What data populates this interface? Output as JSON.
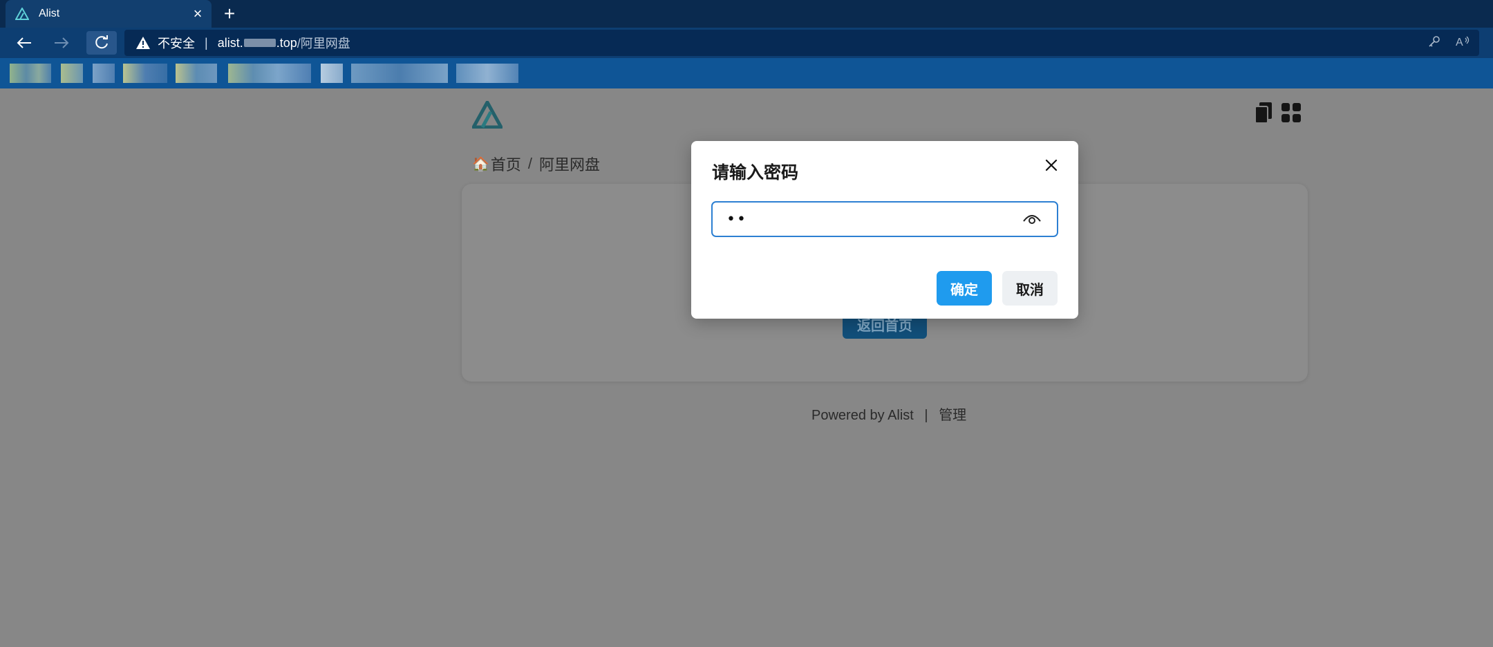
{
  "browser": {
    "tab": {
      "title": "Alist"
    },
    "address": {
      "insecure_label": "不安全",
      "separator": "|",
      "host_prefix": "alist.",
      "host_suffix": ".top",
      "path": "/阿里网盘"
    }
  },
  "page": {
    "breadcrumb": {
      "home": "首页",
      "separator": "/",
      "current": "阿里网盘"
    },
    "home_button": "返回首页",
    "footer": {
      "powered": "Powered by Alist",
      "separator": "|",
      "admin": "管理"
    }
  },
  "modal": {
    "title": "请输入密码",
    "password_value": "••",
    "ok_label": "确定",
    "cancel_label": "取消"
  },
  "colors": {
    "primary": "#1f9bee",
    "focus_border": "#2c7fd2",
    "overlay": "#878787",
    "tabbar": "#0a2a4f",
    "bookmarks": "#0f5596"
  },
  "icons": [
    "alist-favicon",
    "close-icon",
    "plus-icon",
    "back-arrow-icon",
    "forward-arrow-icon",
    "reload-icon",
    "warning-icon",
    "key-icon",
    "read-aloud-icon",
    "alist-logo",
    "copy-icon",
    "grid-icon",
    "home-icon",
    "eye-icon"
  ]
}
